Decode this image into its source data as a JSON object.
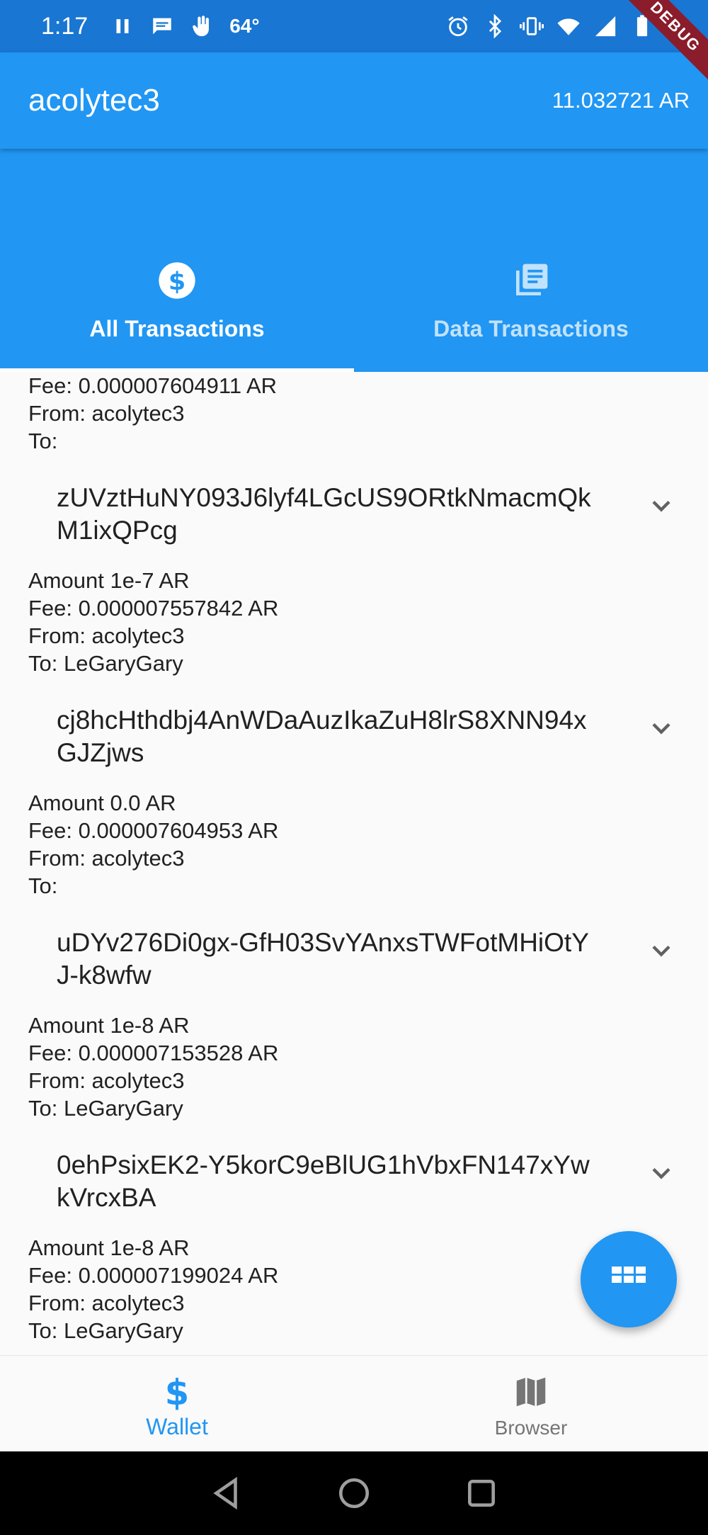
{
  "status_bar": {
    "time": "1:17",
    "temperature": "64°"
  },
  "debug_banner": "DEBUG",
  "app_bar": {
    "title": "acolytec3",
    "balance": "11.032721 AR"
  },
  "tabs": [
    {
      "label": "All Transactions",
      "icon": "dollar-icon",
      "active": true
    },
    {
      "label": "Data Transactions",
      "icon": "library-books-icon",
      "active": false
    }
  ],
  "partial_tx": {
    "fee": "Fee: 0.000007604911 AR",
    "from": "From: acolytec3",
    "to": "To:"
  },
  "transactions": [
    {
      "id": "zUVztHuNY093J6lyf4LGcUS9ORtkNmacmQkM1ixQPcg",
      "amount": "Amount 1e-7 AR",
      "fee": "Fee: 0.000007557842 AR",
      "from": "From: acolytec3",
      "to": "To: LeGaryGary"
    },
    {
      "id": "cj8hcHthdbj4AnWDaAuzIkaZuH8lrS8XNN94xGJZjws",
      "amount": "Amount 0.0 AR",
      "fee": "Fee: 0.000007604953 AR",
      "from": "From: acolytec3",
      "to": "To:"
    },
    {
      "id": "uDYv276Di0gx-GfH03SvYAnxsTWFotMHiOtYJ-k8wfw",
      "amount": "Amount 1e-8 AR",
      "fee": "Fee: 0.000007153528 AR",
      "from": "From: acolytec3",
      "to": "To: LeGaryGary"
    },
    {
      "id": "0ehPsixEK2-Y5korC9eBlUG1hVbxFN147xYwkVrcxBA",
      "amount": "Amount 1e-8 AR",
      "fee": "Fee: 0.000007199024 AR",
      "from": "From: acolytec3",
      "to": "To: LeGaryGary"
    }
  ],
  "fab": {
    "icon": "apps-grid-icon"
  },
  "bottom_nav": [
    {
      "label": "Wallet",
      "icon": "dollar-icon",
      "active": true
    },
    {
      "label": "Browser",
      "icon": "map-icon",
      "active": false
    }
  ],
  "colors": {
    "primary": "#2196f3",
    "status_bar": "#1976d2",
    "debug": "#8a1c2b"
  }
}
